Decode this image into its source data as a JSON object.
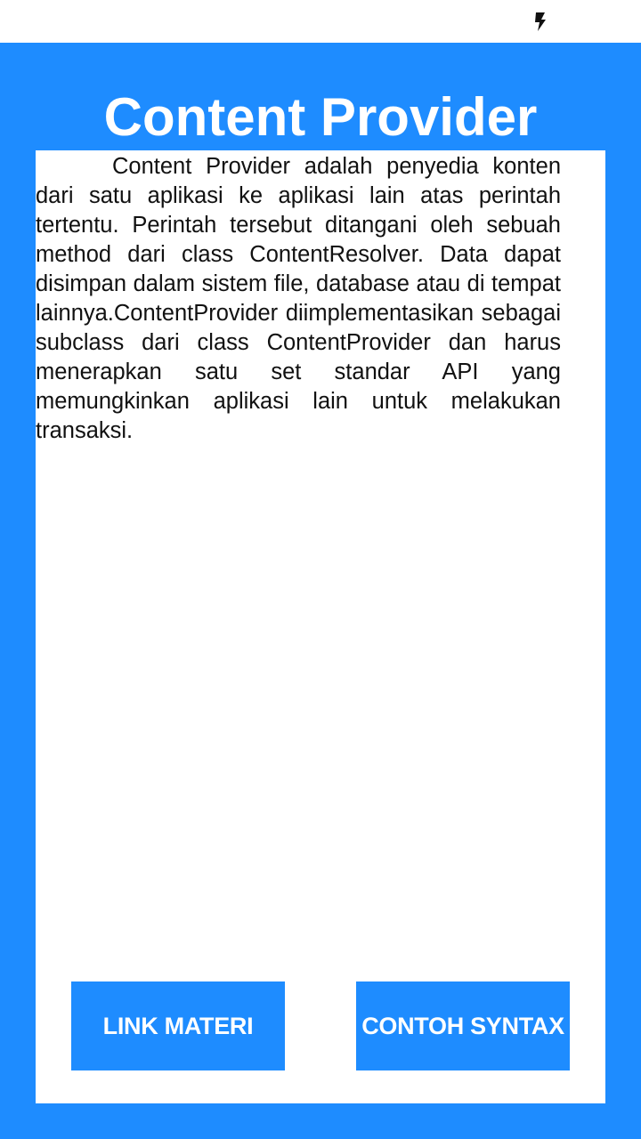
{
  "status_bar": {
    "icons": [
      "charging-bolt-icon"
    ]
  },
  "header": {
    "title": "Content Provider"
  },
  "content": {
    "description": "Content Provider adalah penyedia konten dari satu aplikasi ke aplikasi lain atas perintah tertentu. Perintah tersebut ditangani oleh sebuah method dari class ContentResolver. Data dapat disimpan dalam sistem file, database atau di tempat lainnya.ContentProvider diimplementasikan sebagai subclass dari class ContentProvider dan harus menerapkan satu set standar API yang memungkinkan aplikasi lain untuk melakukan transaksi."
  },
  "buttons": {
    "link_materi": "LINK MATERI",
    "contoh_syntax": "CONTOH SYNTAX"
  },
  "colors": {
    "primary": "#1e8cff",
    "card_background": "#ffffff",
    "text": "#111111"
  }
}
